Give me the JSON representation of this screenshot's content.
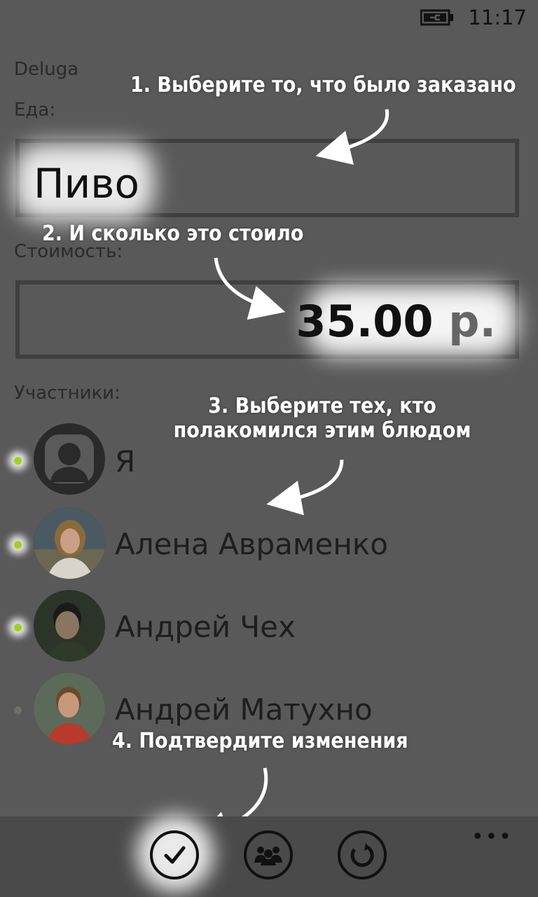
{
  "status_bar": {
    "time": "11:17"
  },
  "app": {
    "name": "Deluga"
  },
  "food": {
    "label": "Еда:",
    "value": "Пиво"
  },
  "cost": {
    "label": "Стоимость:",
    "amount": "35.00",
    "currency": "р."
  },
  "participants": {
    "label": "Участники:",
    "items": [
      {
        "name": "Я",
        "selected": true,
        "avatar": "default-user-icon"
      },
      {
        "name": "Алена Авраменко",
        "selected": true,
        "avatar": "photo"
      },
      {
        "name": "Андрей Чех",
        "selected": true,
        "avatar": "photo"
      },
      {
        "name": "Андрей Матухно",
        "selected": false,
        "avatar": "photo"
      }
    ]
  },
  "hints": {
    "step1": "1. Выберите то, что было заказано",
    "step2": "2. И сколько это стоило",
    "step3_line1": "3. Выберите тех, кто",
    "step3_line2": "полакомился этим блюдом",
    "step4": "4. Подтвердите изменения"
  },
  "app_bar": {
    "buttons": [
      "check-icon",
      "people-icon",
      "refresh-icon"
    ],
    "more": "•••"
  },
  "colors": {
    "accent": "#9fd21c",
    "background": "#595959"
  }
}
